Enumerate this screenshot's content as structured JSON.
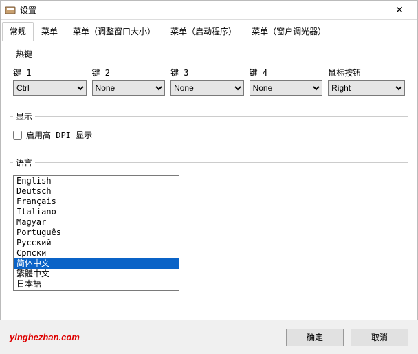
{
  "window": {
    "title": "设置",
    "close_glyph": "✕"
  },
  "tabs": {
    "t0": "常规",
    "t1": "菜单",
    "t2": "菜单（调整窗口大小）",
    "t3": "菜单（启动程序）",
    "t4": "菜单（窗户调光器）"
  },
  "hotkeys": {
    "legend": "热键",
    "k1_label": "键 1",
    "k2_label": "键 2",
    "k3_label": "键 3",
    "k4_label": "键 4",
    "mouse_label": "鼠标按钮",
    "k1_value": "Ctrl",
    "k2_value": "None",
    "k3_value": "None",
    "k4_value": "None",
    "mouse_value": "Right"
  },
  "display": {
    "legend": "显示",
    "dpi_label": "启用高 DPI 显示",
    "dpi_checked": false
  },
  "language": {
    "legend": "语言",
    "selected": "简体中文",
    "items": [
      "English",
      "Deutsch",
      "Français",
      "Italiano",
      "Magyar",
      "Português",
      "Русский",
      "Српски",
      "简体中文",
      "繁體中文",
      "日本語"
    ]
  },
  "footer": {
    "brand": "yinghezhan.com",
    "ok": "确定",
    "cancel": "取消"
  }
}
